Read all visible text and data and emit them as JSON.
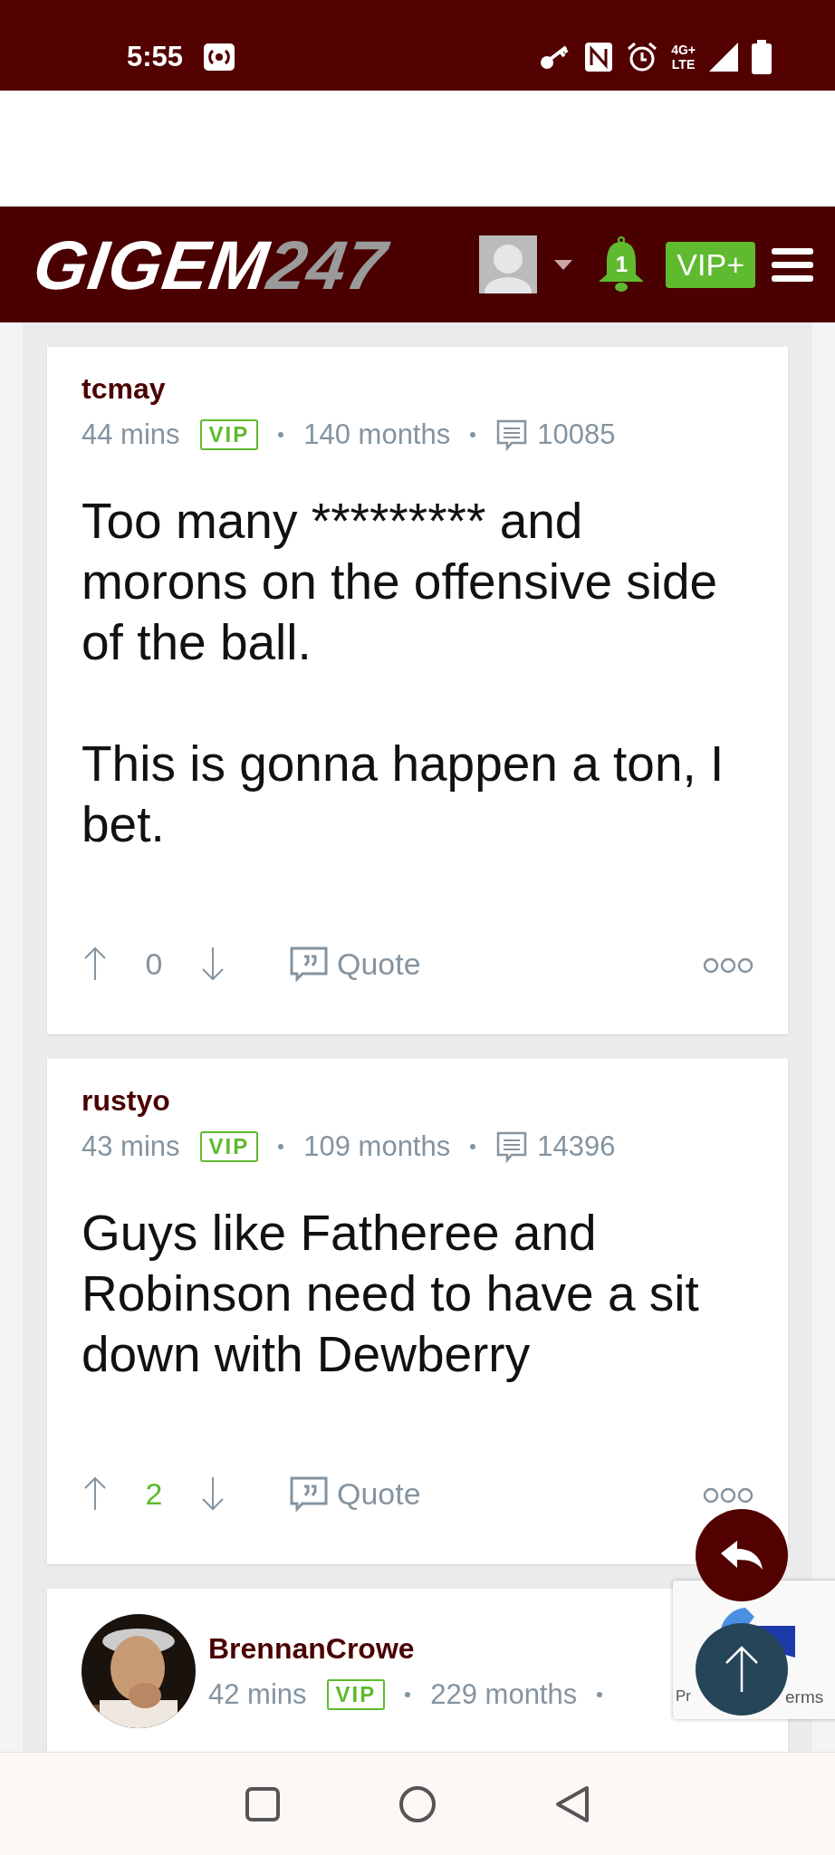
{
  "status_bar": {
    "time": "5:55",
    "network": [
      "4G+",
      "LTE"
    ]
  },
  "header": {
    "logo": {
      "main": "GIGEM",
      "suffix": "247"
    },
    "notifications": "1",
    "vip_button": "VIP+"
  },
  "posts": [
    {
      "username": "tcmay",
      "time": "44 mins",
      "badge": "VIP",
      "tenure": "140 months",
      "post_count": "10085",
      "paragraphs": [
        "Too many ********* and morons on the offensive side of the ball.",
        "This is gonna happen a ton, I bet."
      ],
      "score": "0",
      "score_positive": false,
      "quote": "Quote"
    },
    {
      "username": "rustyo",
      "time": "43 mins",
      "badge": "VIP",
      "tenure": "109 months",
      "post_count": "14396",
      "paragraphs": [
        "Guys like Fatheree and Robinson need to have a sit down with Dewberry"
      ],
      "score": "2",
      "score_positive": true,
      "quote": "Quote"
    },
    {
      "username": "BrennanCrowe",
      "time": "42 mins",
      "badge": "VIP",
      "tenure": "229 months"
    }
  ],
  "recaptcha": {
    "texts": [
      "Pr",
      "erms"
    ]
  }
}
